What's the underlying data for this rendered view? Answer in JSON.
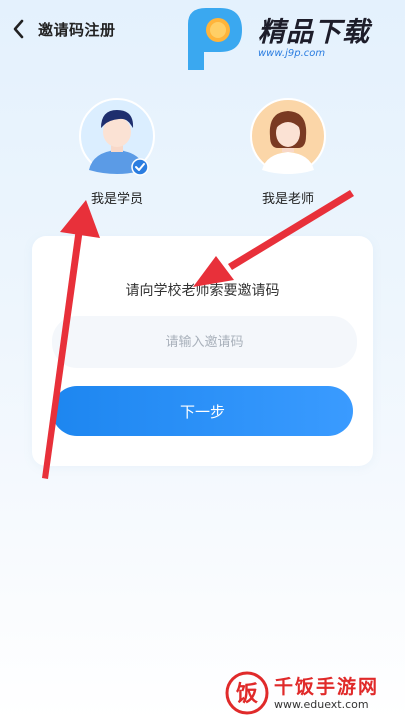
{
  "header": {
    "title": "邀请码注册",
    "back_icon": "back-chevron-icon"
  },
  "watermark_top": {
    "title": "精品下载",
    "url": "www.j9p.com",
    "logo_icon": "p-logo-icon"
  },
  "roles": [
    {
      "label": "我是学员",
      "selected": true,
      "icon": "student-avatar-icon"
    },
    {
      "label": "我是老师",
      "selected": false,
      "icon": "teacher-avatar-icon"
    }
  ],
  "card": {
    "prompt": "请向学校老师索要邀请码",
    "input_placeholder": "请输入邀请码",
    "input_value": "",
    "next_label": "下一步"
  },
  "watermark_bottom": {
    "name": "千饭手游网",
    "url": "www.eduext.com",
    "logo_glyph": "饭"
  },
  "colors": {
    "accent": "#1d86f0",
    "arrow": "#e8303a",
    "check_badge": "#2b7de0"
  }
}
